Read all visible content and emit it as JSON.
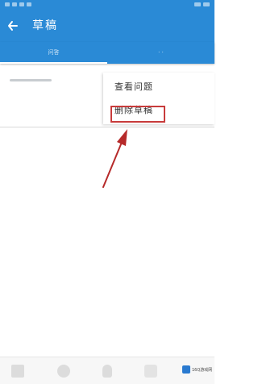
{
  "header": {
    "title": "草稿"
  },
  "tabs": [
    {
      "label": "问答"
    },
    {
      "label": "· ·"
    }
  ],
  "menu": {
    "items": [
      {
        "label": "查看问题"
      },
      {
        "label": "删除草稿"
      }
    ]
  },
  "watermark": {
    "text": "16Q游戏网"
  },
  "colors": {
    "primary": "#2a8ad6",
    "highlight": "#c83b3b"
  }
}
